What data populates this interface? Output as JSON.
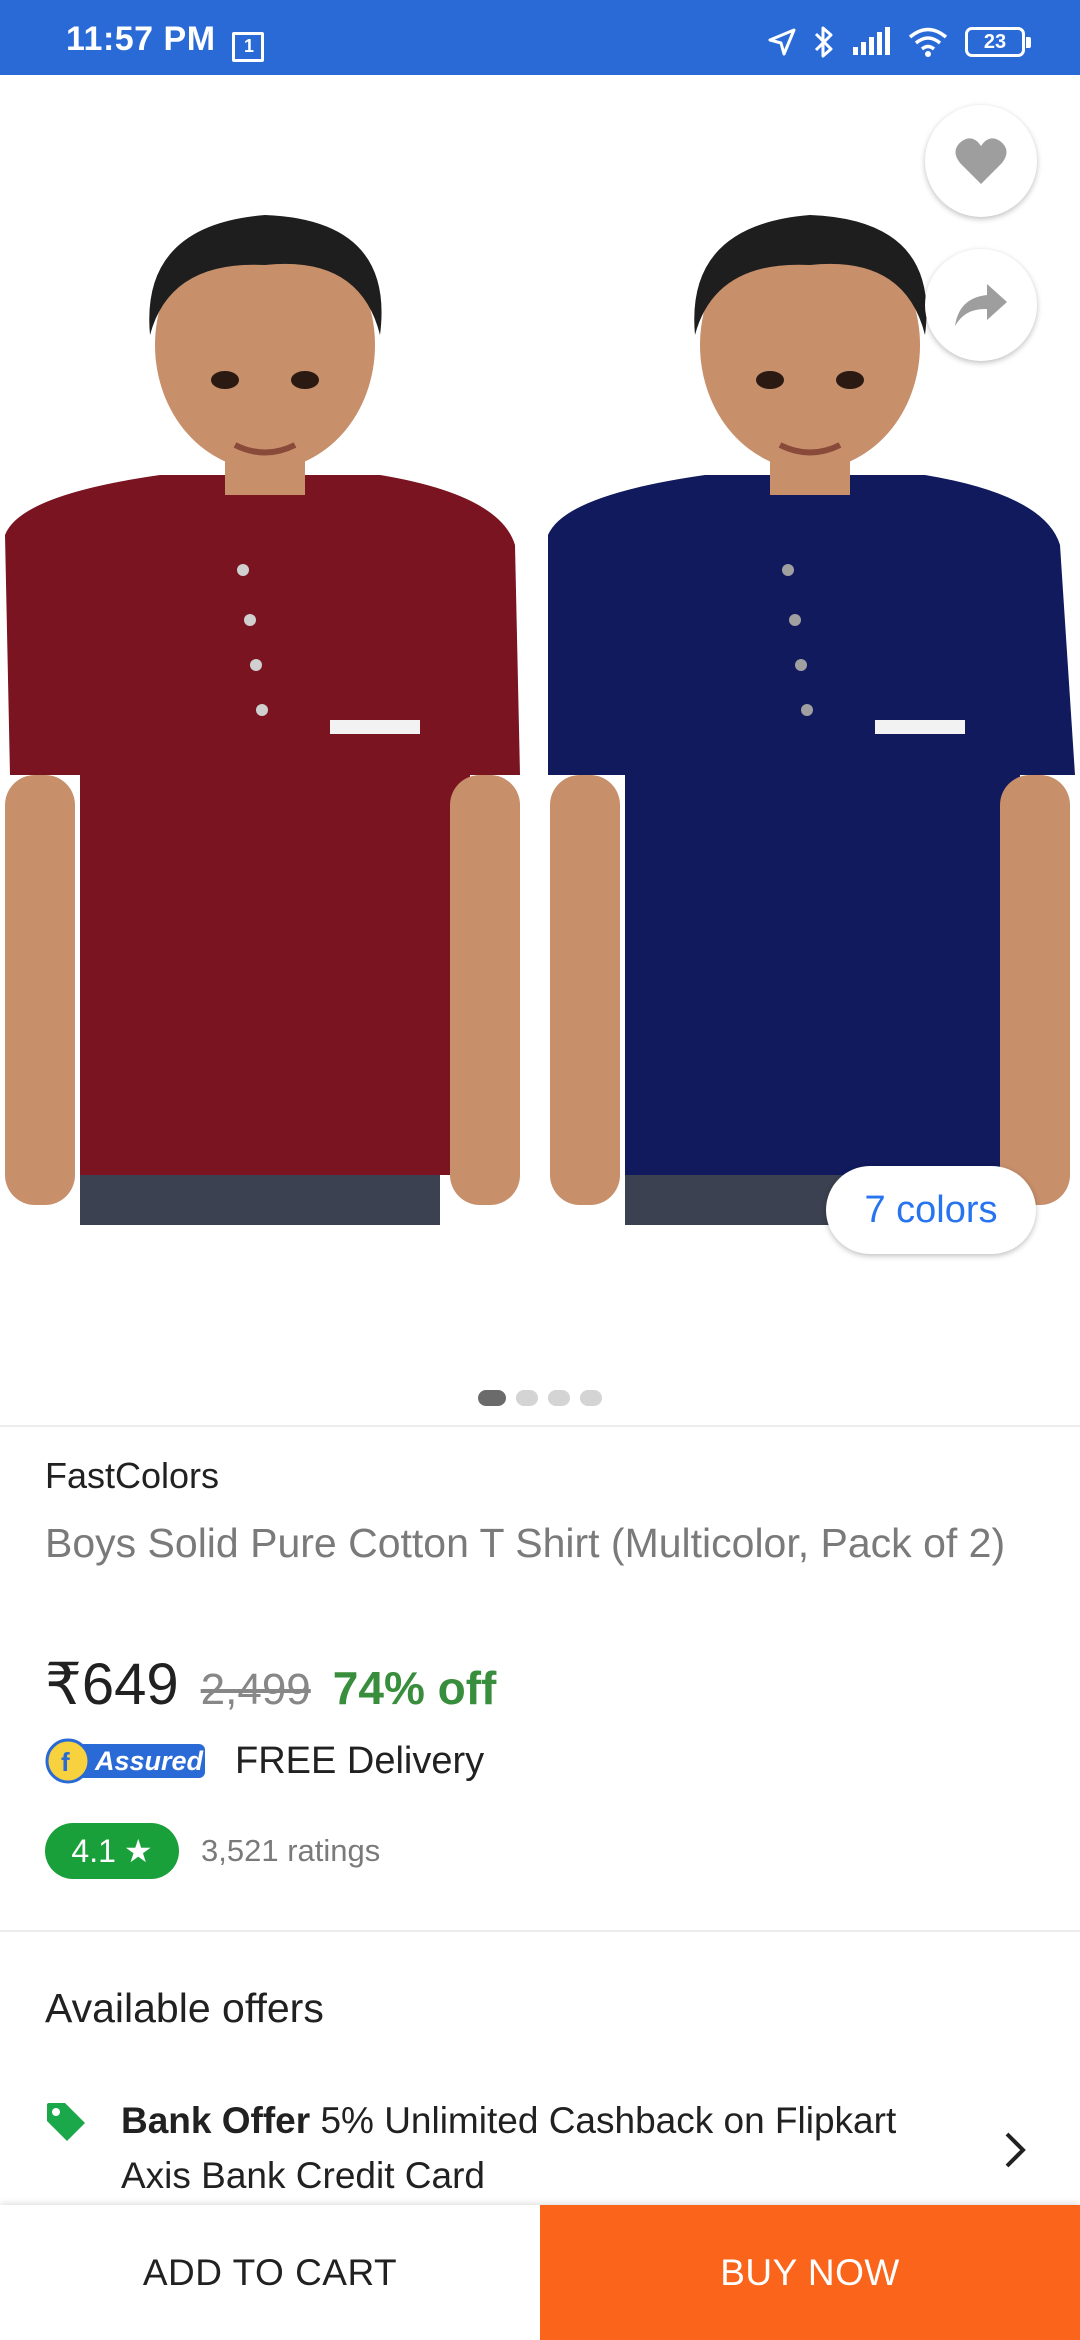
{
  "status_bar": {
    "time": "11:57 PM",
    "screen_badge": "1",
    "battery": "23",
    "icons": [
      "location-icon",
      "bluetooth-icon",
      "signal-icon",
      "wifi-icon",
      "battery-icon"
    ]
  },
  "gallery": {
    "colors_label": "7 colors",
    "dot_count": 4,
    "active_dot": 0,
    "shirt_colors": [
      "#7a1420",
      "#101a5c"
    ]
  },
  "product": {
    "brand": "FastColors",
    "title": "Boys Solid Pure Cotton T Shirt (Multicolor, Pack of 2)",
    "price": "₹649",
    "mrp": "2,499",
    "discount": "74% off",
    "assured_label": "Assured",
    "delivery": "FREE Delivery",
    "rating": "4.1",
    "rating_star": "★",
    "ratings_count": "3,521 ratings"
  },
  "offers": {
    "title": "Available offers",
    "items": [
      {
        "type": "Bank Offer",
        "text": "5% Unlimited Cashback on Flipkart Axis Bank Credit Card"
      }
    ]
  },
  "actions": {
    "add_to_cart": "ADD TO CART",
    "buy_now": "BUY NOW"
  },
  "colors": {
    "status_bar": "#2a6ad6",
    "accent_blue": "#2874f0",
    "discount_green": "#388e3c",
    "rating_green": "#1aa03a",
    "buy_orange": "#fb641b"
  }
}
